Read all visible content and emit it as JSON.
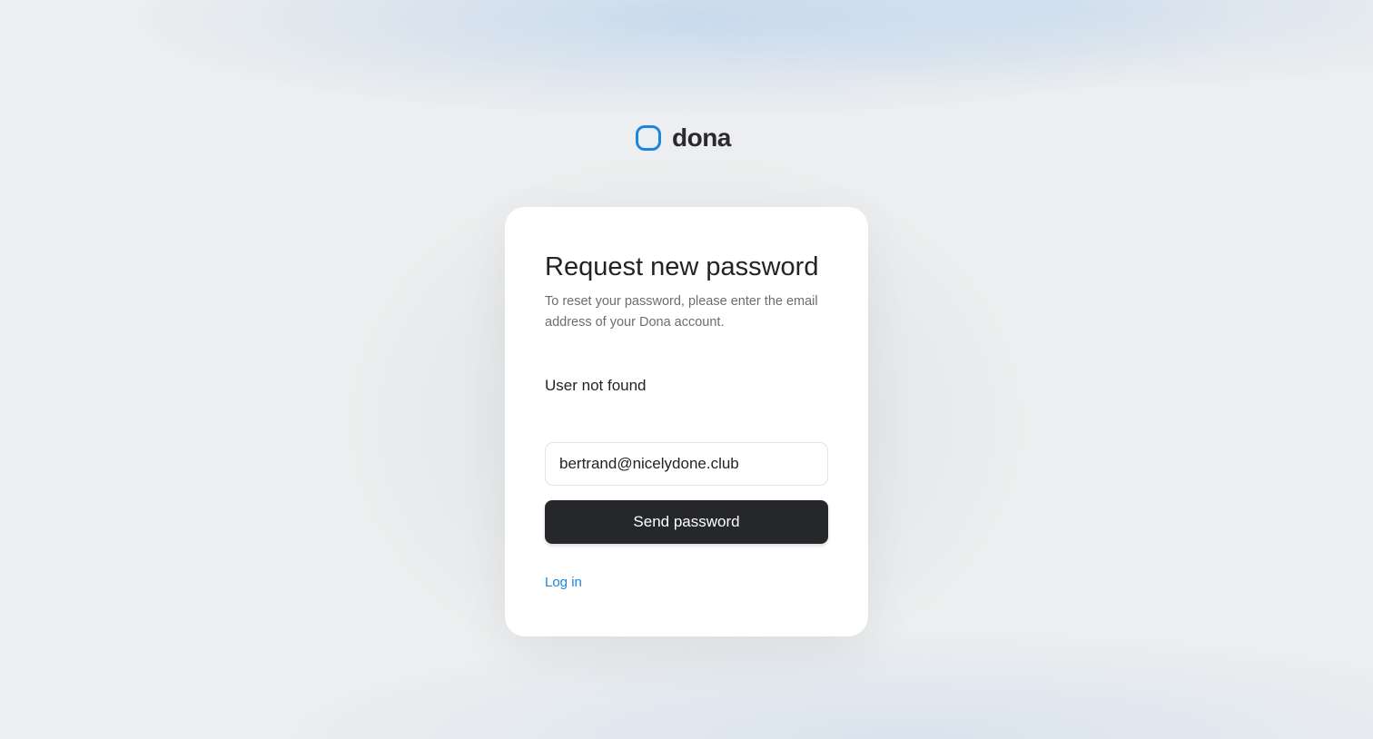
{
  "brand": {
    "name": "dona",
    "accent_color": "#1b86e0",
    "icon": "rounded-square-logo-icon"
  },
  "form": {
    "title": "Request new password",
    "subtitle": "To reset your password, please enter the email address of your Dona account.",
    "status_message": "User not found",
    "email_value": "bertrand@nicelydone.club",
    "submit_label": "Send password",
    "login_link": "Log in"
  }
}
